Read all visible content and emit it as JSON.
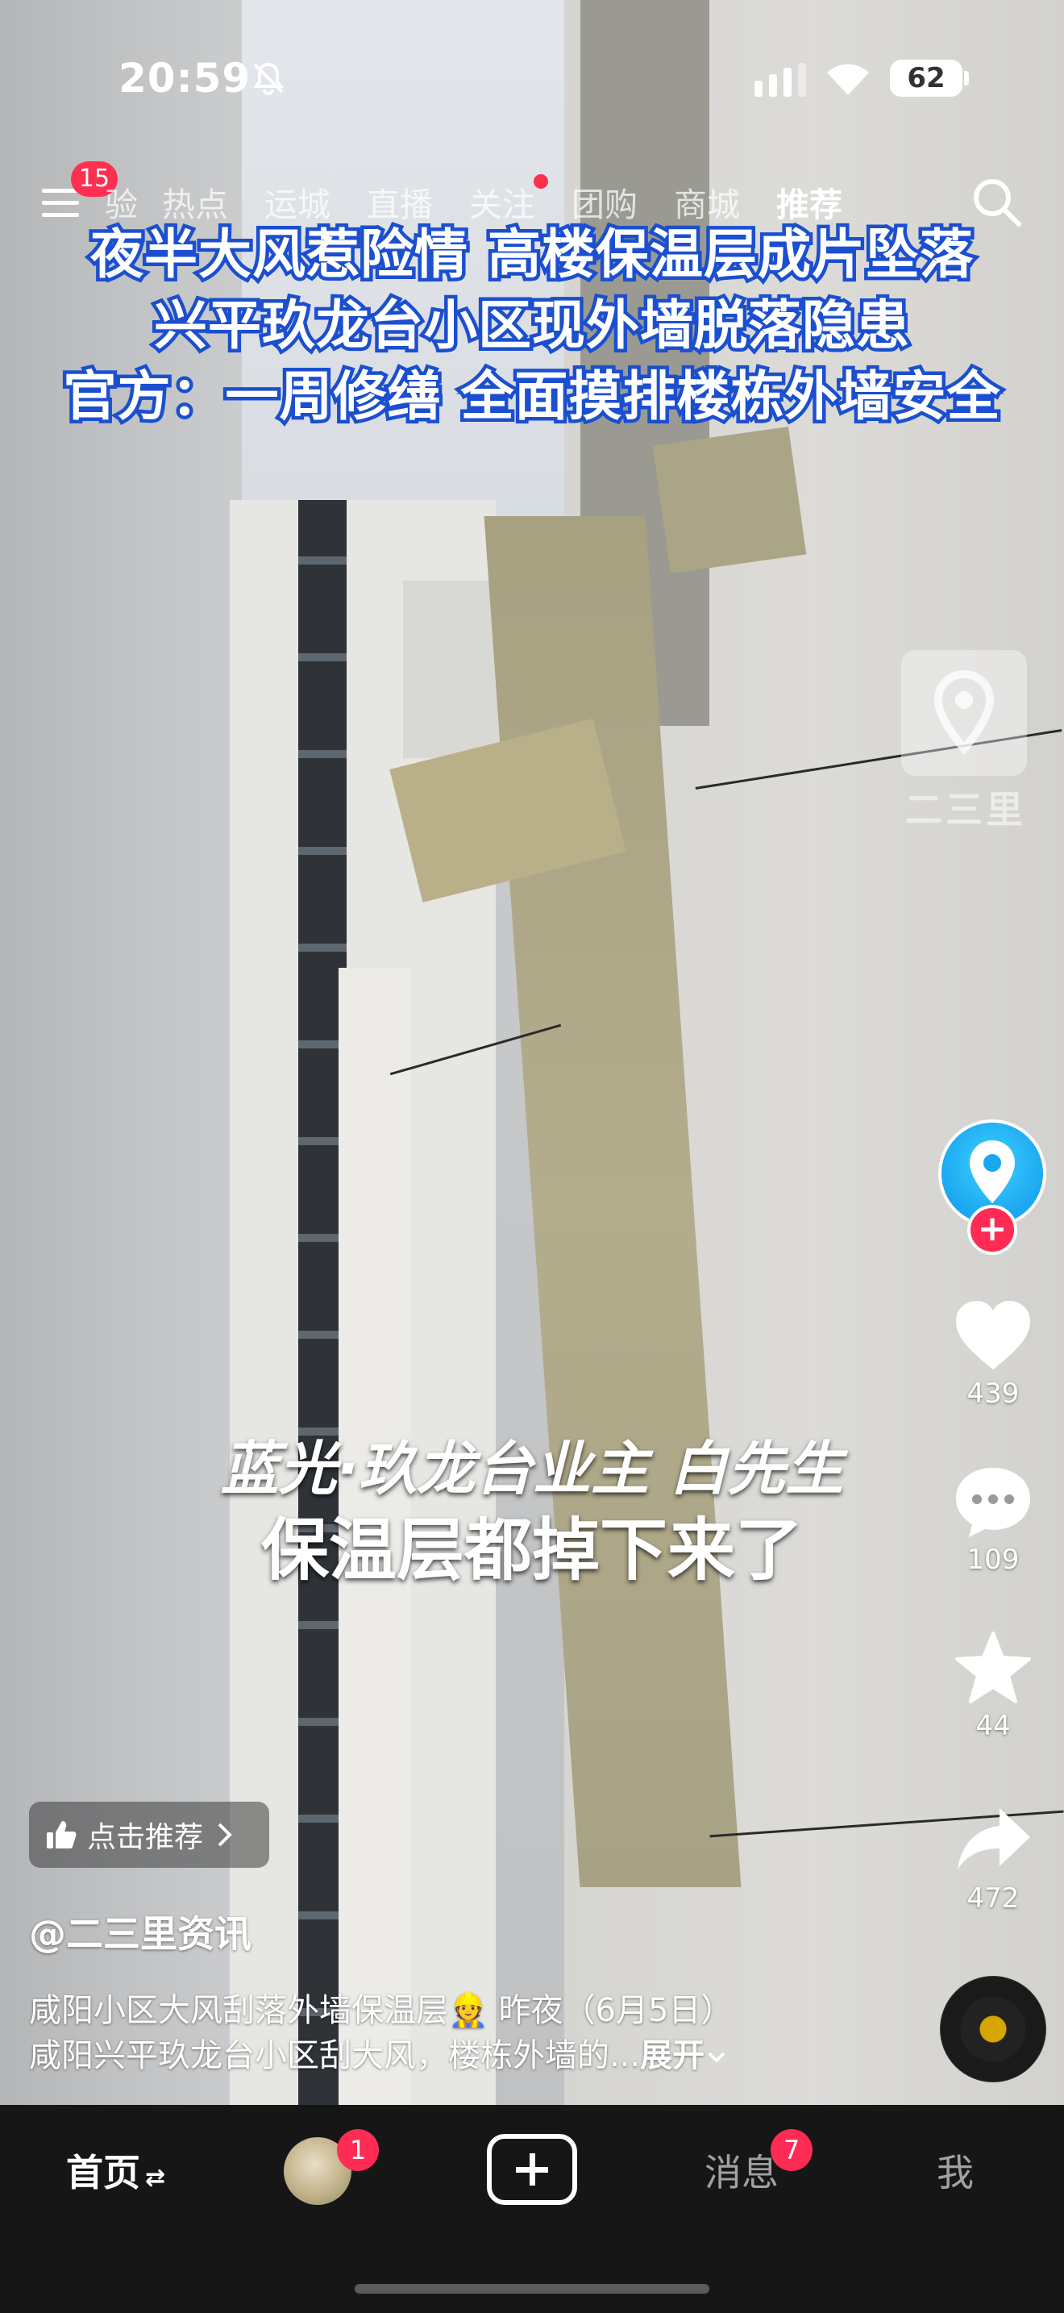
{
  "status_bar": {
    "time": "20:59",
    "battery": "62"
  },
  "top_nav": {
    "menu_badge": "15",
    "tabs": [
      {
        "label": "验"
      },
      {
        "label": "热点"
      },
      {
        "label": "运城"
      },
      {
        "label": "直播"
      },
      {
        "label": "关注"
      },
      {
        "label": "团购"
      },
      {
        "label": "商城"
      },
      {
        "label": "推荐"
      }
    ]
  },
  "video": {
    "headline_lines": [
      "夜半大风惹险情 高楼保温层成片坠落",
      "兴平玖龙台小区现外墙脱落隐患",
      "官方：一周修缮 全面摸排楼栋外墙安全"
    ],
    "watermark": "二三里",
    "subtitle_speaker": "蓝光·玖龙台业主 白先生",
    "subtitle_quote": "保温层都掉下来了"
  },
  "actions": {
    "likes": "439",
    "comments": "109",
    "favorites": "44",
    "shares": "472"
  },
  "info": {
    "recommend_label": "点击推荐",
    "author": "@二三里资讯",
    "desc_line_1": "咸阳小区大风刮落外墙保温层👷 昨夜（6月5日）",
    "desc_line_2": "咸阳兴平玖龙台小区刮大风，楼栋外墙的...",
    "expand": "展开"
  },
  "tab_bar": {
    "home": "首页",
    "friends_badge": "1",
    "messages": "消息",
    "messages_badge": "7",
    "me": "我"
  }
}
